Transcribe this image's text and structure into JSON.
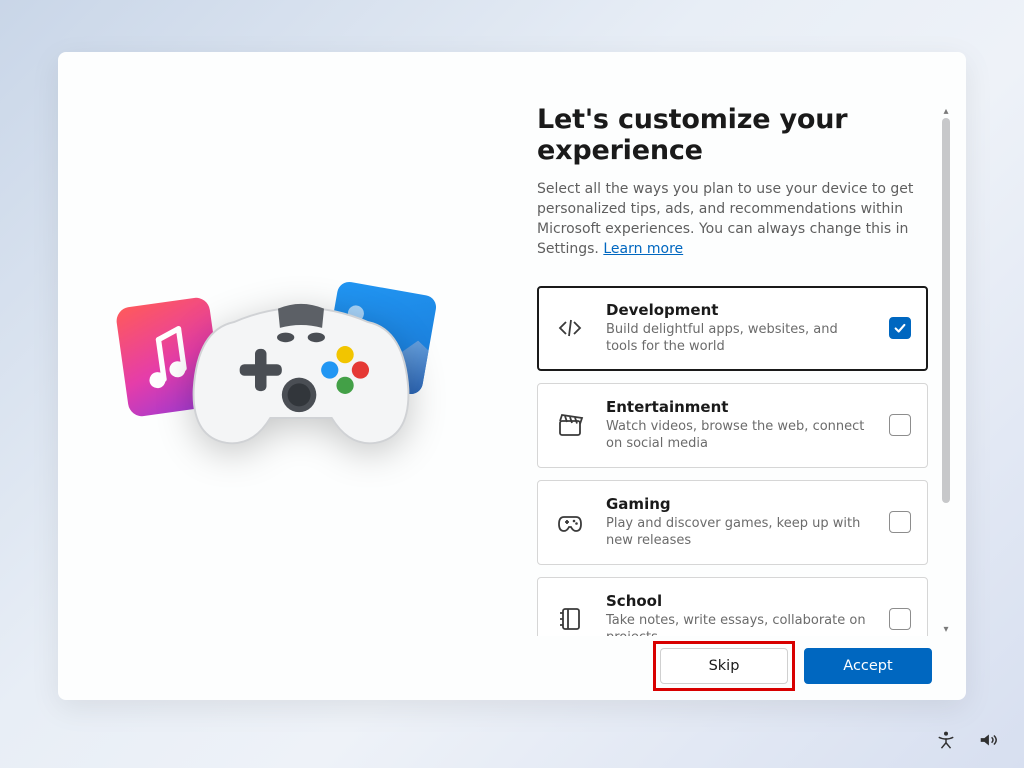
{
  "heading": "Let's customize your experience",
  "description_pre": "Select all the ways you plan to use your device to get personalized tips, ads, and recommendations within Microsoft experiences. You can always change this in Settings. ",
  "learn_more": "Learn more",
  "options": [
    {
      "title": "Development",
      "subtitle": "Build delightful apps, websites, and tools for the world",
      "checked": true
    },
    {
      "title": "Entertainment",
      "subtitle": "Watch videos, browse the web, connect on social media",
      "checked": false
    },
    {
      "title": "Gaming",
      "subtitle": "Play and discover games, keep up with new releases",
      "checked": false
    },
    {
      "title": "School",
      "subtitle": "Take notes, write essays, collaborate on projects",
      "checked": false
    }
  ],
  "buttons": {
    "skip": "Skip",
    "accept": "Accept"
  },
  "colors": {
    "accent": "#0067c0",
    "highlight": "#d80000"
  }
}
